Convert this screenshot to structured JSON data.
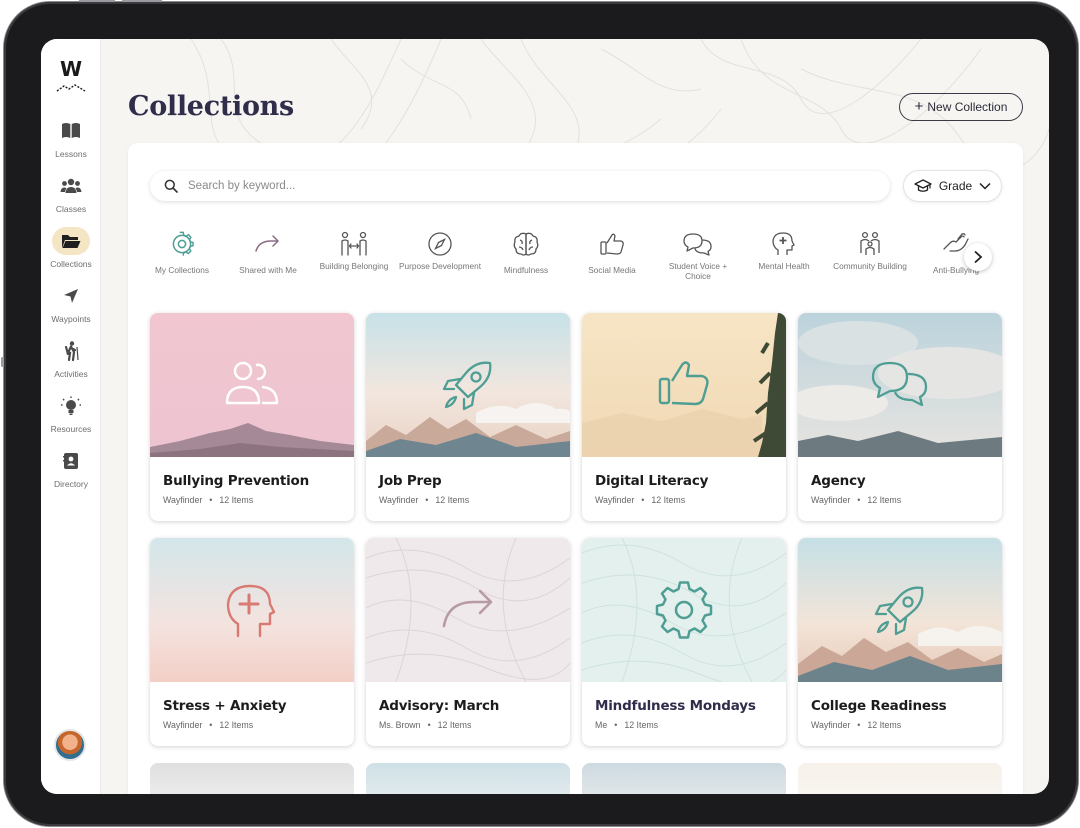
{
  "app": {
    "logo_text": "W"
  },
  "sidebar": {
    "items": [
      {
        "label": "Lessons",
        "icon": "book-icon"
      },
      {
        "label": "Classes",
        "icon": "people-icon"
      },
      {
        "label": "Collections",
        "icon": "folder-icon",
        "active": true
      },
      {
        "label": "Waypoints",
        "icon": "navigation-icon"
      },
      {
        "label": "Activities",
        "icon": "hiker-icon"
      },
      {
        "label": "Resources",
        "icon": "lightbulb-icon"
      },
      {
        "label": "Directory",
        "icon": "contact-card-icon"
      }
    ]
  },
  "header": {
    "title": "Collections",
    "new_button_label": "New Collection"
  },
  "search": {
    "placeholder": "Search by keyword...",
    "value": ""
  },
  "filter": {
    "label": "Grade",
    "icon": "graduation-cap-icon"
  },
  "categories": [
    {
      "label": "My Collections",
      "icon": "gear-icon"
    },
    {
      "label": "Shared with Me",
      "icon": "share-arrow-icon"
    },
    {
      "label": "Building Belonging",
      "icon": "belonging-icon"
    },
    {
      "label": "Purpose Development",
      "icon": "compass-icon"
    },
    {
      "label": "Mindfulness",
      "icon": "brain-icon"
    },
    {
      "label": "Social Media",
      "icon": "thumbs-up-icon"
    },
    {
      "label": "Student Voice + Choice",
      "icon": "chat-bubbles-icon"
    },
    {
      "label": "Mental Health",
      "icon": "head-cross-icon"
    },
    {
      "label": "Community Building",
      "icon": "community-icon"
    },
    {
      "label": "Anti-Bullying",
      "icon": "hand-icon"
    }
  ],
  "cards": [
    {
      "title": "Bullying Prevention",
      "author": "Wayfinder",
      "count": "12 Items",
      "icon": "people-icon"
    },
    {
      "title": "Job Prep",
      "author": "Wayfinder",
      "count": "12 Items",
      "icon": "rocket-icon"
    },
    {
      "title": "Digital Literacy",
      "author": "Wayfinder",
      "count": "12 Items",
      "icon": "thumbs-up-icon"
    },
    {
      "title": "Agency",
      "author": "Wayfinder",
      "count": "12 Items",
      "icon": "chat-bubbles-icon"
    },
    {
      "title": "Stress + Anxiety",
      "author": "Wayfinder",
      "count": "12 Items",
      "icon": "head-cross-icon"
    },
    {
      "title": "Advisory: March",
      "author": "Ms. Brown",
      "count": "12 Items",
      "icon": "share-arrow-icon"
    },
    {
      "title": "Mindfulness Mondays",
      "author": "Me",
      "count": "12 Items",
      "icon": "gear-icon"
    },
    {
      "title": "College Readiness",
      "author": "Wayfinder",
      "count": "12 Items",
      "icon": "rocket-icon"
    }
  ],
  "colors": {
    "accent_teal": "#4f9e94",
    "title_navy": "#2f2d4a",
    "active_nav_bg": "#f4e6c4",
    "coral": "#d97a72",
    "mauve": "#b899a6"
  }
}
